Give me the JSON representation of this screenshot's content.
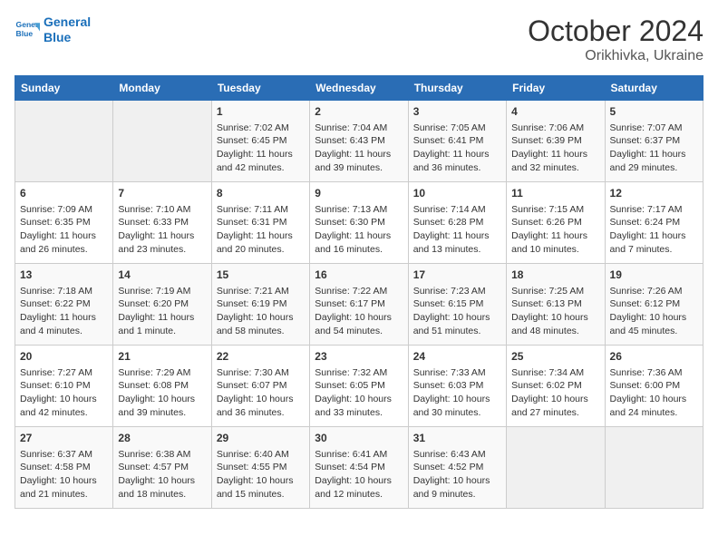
{
  "header": {
    "logo_line1": "General",
    "logo_line2": "Blue",
    "month": "October 2024",
    "location": "Orikhivka, Ukraine"
  },
  "days_of_week": [
    "Sunday",
    "Monday",
    "Tuesday",
    "Wednesday",
    "Thursday",
    "Friday",
    "Saturday"
  ],
  "weeks": [
    [
      {
        "day": "",
        "content": ""
      },
      {
        "day": "",
        "content": ""
      },
      {
        "day": "1",
        "content": "Sunrise: 7:02 AM\nSunset: 6:45 PM\nDaylight: 11 hours\nand 42 minutes."
      },
      {
        "day": "2",
        "content": "Sunrise: 7:04 AM\nSunset: 6:43 PM\nDaylight: 11 hours\nand 39 minutes."
      },
      {
        "day": "3",
        "content": "Sunrise: 7:05 AM\nSunset: 6:41 PM\nDaylight: 11 hours\nand 36 minutes."
      },
      {
        "day": "4",
        "content": "Sunrise: 7:06 AM\nSunset: 6:39 PM\nDaylight: 11 hours\nand 32 minutes."
      },
      {
        "day": "5",
        "content": "Sunrise: 7:07 AM\nSunset: 6:37 PM\nDaylight: 11 hours\nand 29 minutes."
      }
    ],
    [
      {
        "day": "6",
        "content": "Sunrise: 7:09 AM\nSunset: 6:35 PM\nDaylight: 11 hours\nand 26 minutes."
      },
      {
        "day": "7",
        "content": "Sunrise: 7:10 AM\nSunset: 6:33 PM\nDaylight: 11 hours\nand 23 minutes."
      },
      {
        "day": "8",
        "content": "Sunrise: 7:11 AM\nSunset: 6:31 PM\nDaylight: 11 hours\nand 20 minutes."
      },
      {
        "day": "9",
        "content": "Sunrise: 7:13 AM\nSunset: 6:30 PM\nDaylight: 11 hours\nand 16 minutes."
      },
      {
        "day": "10",
        "content": "Sunrise: 7:14 AM\nSunset: 6:28 PM\nDaylight: 11 hours\nand 13 minutes."
      },
      {
        "day": "11",
        "content": "Sunrise: 7:15 AM\nSunset: 6:26 PM\nDaylight: 11 hours\nand 10 minutes."
      },
      {
        "day": "12",
        "content": "Sunrise: 7:17 AM\nSunset: 6:24 PM\nDaylight: 11 hours\nand 7 minutes."
      }
    ],
    [
      {
        "day": "13",
        "content": "Sunrise: 7:18 AM\nSunset: 6:22 PM\nDaylight: 11 hours\nand 4 minutes."
      },
      {
        "day": "14",
        "content": "Sunrise: 7:19 AM\nSunset: 6:20 PM\nDaylight: 11 hours\nand 1 minute."
      },
      {
        "day": "15",
        "content": "Sunrise: 7:21 AM\nSunset: 6:19 PM\nDaylight: 10 hours\nand 58 minutes."
      },
      {
        "day": "16",
        "content": "Sunrise: 7:22 AM\nSunset: 6:17 PM\nDaylight: 10 hours\nand 54 minutes."
      },
      {
        "day": "17",
        "content": "Sunrise: 7:23 AM\nSunset: 6:15 PM\nDaylight: 10 hours\nand 51 minutes."
      },
      {
        "day": "18",
        "content": "Sunrise: 7:25 AM\nSunset: 6:13 PM\nDaylight: 10 hours\nand 48 minutes."
      },
      {
        "day": "19",
        "content": "Sunrise: 7:26 AM\nSunset: 6:12 PM\nDaylight: 10 hours\nand 45 minutes."
      }
    ],
    [
      {
        "day": "20",
        "content": "Sunrise: 7:27 AM\nSunset: 6:10 PM\nDaylight: 10 hours\nand 42 minutes."
      },
      {
        "day": "21",
        "content": "Sunrise: 7:29 AM\nSunset: 6:08 PM\nDaylight: 10 hours\nand 39 minutes."
      },
      {
        "day": "22",
        "content": "Sunrise: 7:30 AM\nSunset: 6:07 PM\nDaylight: 10 hours\nand 36 minutes."
      },
      {
        "day": "23",
        "content": "Sunrise: 7:32 AM\nSunset: 6:05 PM\nDaylight: 10 hours\nand 33 minutes."
      },
      {
        "day": "24",
        "content": "Sunrise: 7:33 AM\nSunset: 6:03 PM\nDaylight: 10 hours\nand 30 minutes."
      },
      {
        "day": "25",
        "content": "Sunrise: 7:34 AM\nSunset: 6:02 PM\nDaylight: 10 hours\nand 27 minutes."
      },
      {
        "day": "26",
        "content": "Sunrise: 7:36 AM\nSunset: 6:00 PM\nDaylight: 10 hours\nand 24 minutes."
      }
    ],
    [
      {
        "day": "27",
        "content": "Sunrise: 6:37 AM\nSunset: 4:58 PM\nDaylight: 10 hours\nand 21 minutes."
      },
      {
        "day": "28",
        "content": "Sunrise: 6:38 AM\nSunset: 4:57 PM\nDaylight: 10 hours\nand 18 minutes."
      },
      {
        "day": "29",
        "content": "Sunrise: 6:40 AM\nSunset: 4:55 PM\nDaylight: 10 hours\nand 15 minutes."
      },
      {
        "day": "30",
        "content": "Sunrise: 6:41 AM\nSunset: 4:54 PM\nDaylight: 10 hours\nand 12 minutes."
      },
      {
        "day": "31",
        "content": "Sunrise: 6:43 AM\nSunset: 4:52 PM\nDaylight: 10 hours\nand 9 minutes."
      },
      {
        "day": "",
        "content": ""
      },
      {
        "day": "",
        "content": ""
      }
    ]
  ]
}
